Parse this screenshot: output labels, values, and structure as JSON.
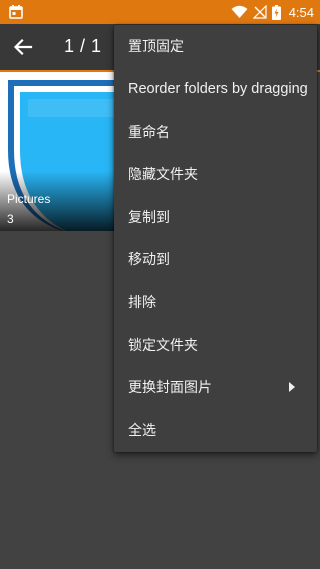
{
  "status_bar": {
    "time": "4:54",
    "icons": [
      "calendar-icon",
      "wifi-icon",
      "no-signal-icon",
      "battery-charging-icon"
    ],
    "background": "#e07810"
  },
  "toolbar": {
    "counter": "1 / 1",
    "back_icon": "back-arrow-icon"
  },
  "folders": [
    {
      "name": "Pictures",
      "count": "3"
    }
  ],
  "menu": {
    "items": [
      {
        "label": "置顶固定"
      },
      {
        "label": "Reorder folders by dragging"
      },
      {
        "label": "重命名"
      },
      {
        "label": "隐藏文件夹"
      },
      {
        "label": "复制到"
      },
      {
        "label": "移动到"
      },
      {
        "label": "排除"
      },
      {
        "label": "锁定文件夹"
      },
      {
        "label": "更换封面图片",
        "submenu": true
      },
      {
        "label": "全选"
      }
    ]
  },
  "colors": {
    "accent": "#e07810",
    "background": "#424242",
    "menu_background": "#3f3f3f",
    "thumb_blue": "#29b6f6"
  }
}
